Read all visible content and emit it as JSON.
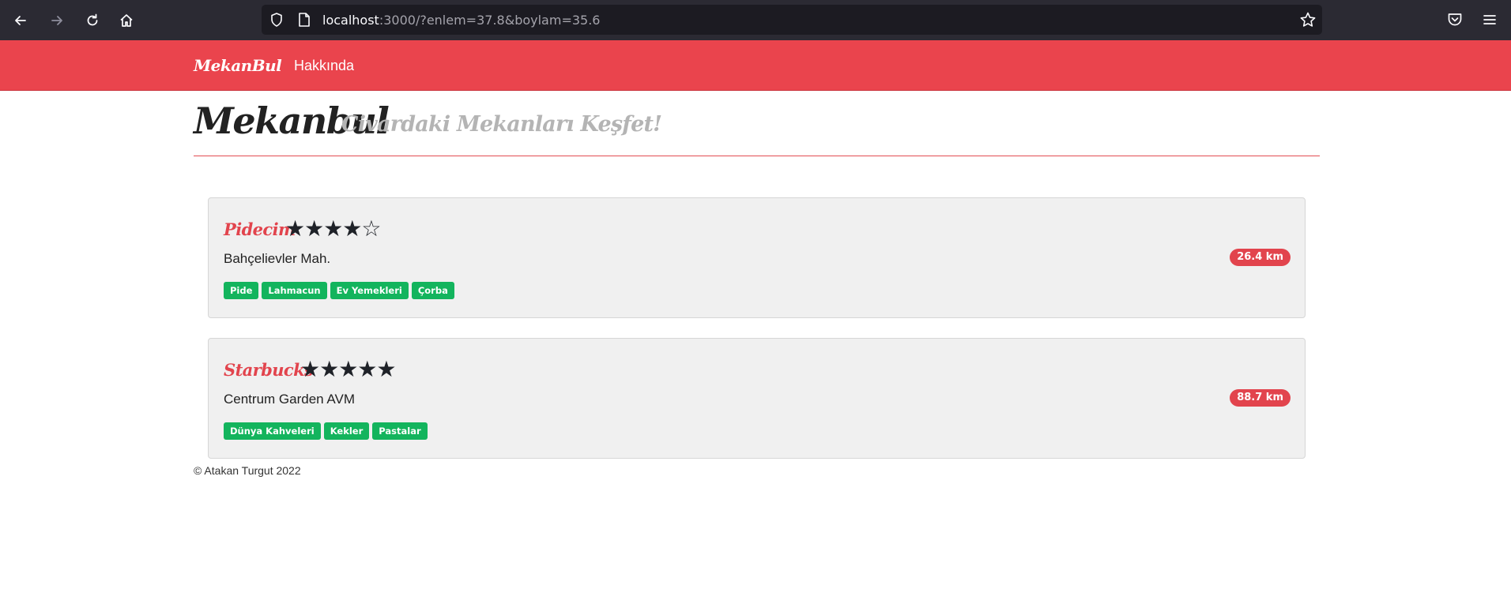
{
  "browser": {
    "url_host": "localhost",
    "url_rest": ":3000/?enlem=37.8&boylam=35.6",
    "icons": [
      "back-arrow-icon",
      "forward-arrow-icon",
      "reload-icon",
      "home-icon",
      "shield-icon",
      "page-icon",
      "star-icon",
      "pocket-icon",
      "menu-icon"
    ]
  },
  "navbar": {
    "brand": "MekanBul",
    "links": [
      "Hakkında"
    ]
  },
  "header": {
    "title": "Mekanbul",
    "subtitle": "Civardaki Mekanları Keşfet!"
  },
  "places": [
    {
      "name": "Pidecim",
      "rating": 4,
      "stars": "★★★★☆",
      "address": "Bahçelievler Mah.",
      "distance": "26.4 km",
      "tags": [
        "Pide",
        "Lahmacun",
        "Ev Yemekleri",
        "Çorba"
      ]
    },
    {
      "name": "Starbucks",
      "rating": 5,
      "stars": "★★★★★",
      "address": "Centrum Garden AVM",
      "distance": "88.7 km",
      "tags": [
        "Dünya Kahveleri",
        "Kekler",
        "Pastalar"
      ]
    }
  ],
  "footer": {
    "text": "© Atakan Turgut 2022"
  },
  "colors": {
    "brand_red": "#ea444d",
    "tag_green": "#13b45d",
    "browser_dark": "#2b2a33"
  }
}
